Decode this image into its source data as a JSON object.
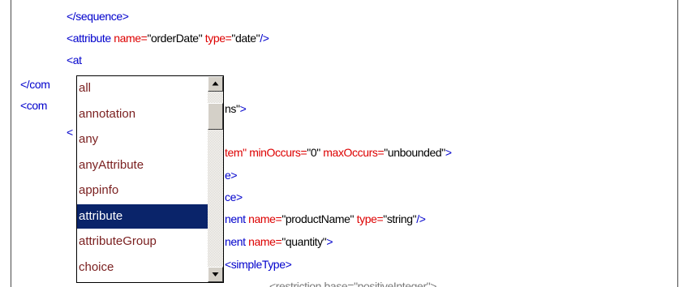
{
  "editor": {
    "lines": [
      {
        "id": "l1",
        "tokens": [
          {
            "c": "tag",
            "t": "</sequence>"
          }
        ]
      },
      {
        "id": "l2",
        "tokens": [
          {
            "c": "tag",
            "t": "<attribute "
          },
          {
            "c": "attr",
            "t": "name="
          },
          {
            "c": "val",
            "t": "\"orderDate\" "
          },
          {
            "c": "attr",
            "t": "type="
          },
          {
            "c": "val",
            "t": "\"date\""
          },
          {
            "c": "tag",
            "t": "/>"
          }
        ]
      },
      {
        "id": "l3",
        "tokens": [
          {
            "c": "tag",
            "t": "<at"
          }
        ]
      },
      {
        "id": "l4",
        "tokens": [
          {
            "c": "tag",
            "t": "</com"
          }
        ]
      },
      {
        "id": "l5",
        "tokens": [
          {
            "c": "tag",
            "t": "<com"
          }
        ]
      },
      {
        "id": "l5r",
        "tokens": [
          {
            "c": "val",
            "t": "ns\""
          },
          {
            "c": "tag",
            "t": ">"
          }
        ]
      },
      {
        "id": "l6",
        "tokens": [
          {
            "c": "tag",
            "t": "<"
          }
        ]
      },
      {
        "id": "l7r",
        "tokens": [
          {
            "c": "attr",
            "t": "tem\" minOccurs="
          },
          {
            "c": "val",
            "t": "\"0\" "
          },
          {
            "c": "attr",
            "t": "maxOccurs="
          },
          {
            "c": "val",
            "t": "\"unbounded\""
          },
          {
            "c": "tag",
            "t": ">"
          }
        ]
      },
      {
        "id": "l8r",
        "tokens": [
          {
            "c": "tag",
            "t": "e>"
          }
        ]
      },
      {
        "id": "l9r",
        "tokens": [
          {
            "c": "tag",
            "t": "ce>"
          }
        ]
      },
      {
        "id": "l10r",
        "tokens": [
          {
            "c": "tag",
            "t": "nent "
          },
          {
            "c": "attr",
            "t": "name="
          },
          {
            "c": "val",
            "t": "\"productName\" "
          },
          {
            "c": "attr",
            "t": "type="
          },
          {
            "c": "val",
            "t": "\"string\""
          },
          {
            "c": "tag",
            "t": "/>"
          }
        ]
      },
      {
        "id": "l11r",
        "tokens": [
          {
            "c": "tag",
            "t": "nent "
          },
          {
            "c": "attr",
            "t": "name="
          },
          {
            "c": "val",
            "t": "\"quantity\""
          },
          {
            "c": "tag",
            "t": ">"
          }
        ]
      },
      {
        "id": "l12r",
        "tokens": [
          {
            "c": "tag",
            "t": "<simpleType>"
          }
        ]
      },
      {
        "id": "l13r",
        "tokens": [
          {
            "c": "dim",
            "t": "<restriction base=\"positiveInteger\">"
          }
        ]
      }
    ]
  },
  "autocomplete": {
    "items": [
      "all",
      "annotation",
      "any",
      "anyAttribute",
      "appinfo",
      "attribute",
      "attributeGroup",
      "choice"
    ],
    "selected_index": 5
  },
  "icons": {
    "scroll_up": "arrow-up-icon",
    "scroll_down": "arrow-down-icon"
  },
  "colors": {
    "tag": "#0000cc",
    "attribute": "#dd0000",
    "value": "#000000",
    "selection": "#0a246a",
    "item_text": "#7a1f1f"
  }
}
